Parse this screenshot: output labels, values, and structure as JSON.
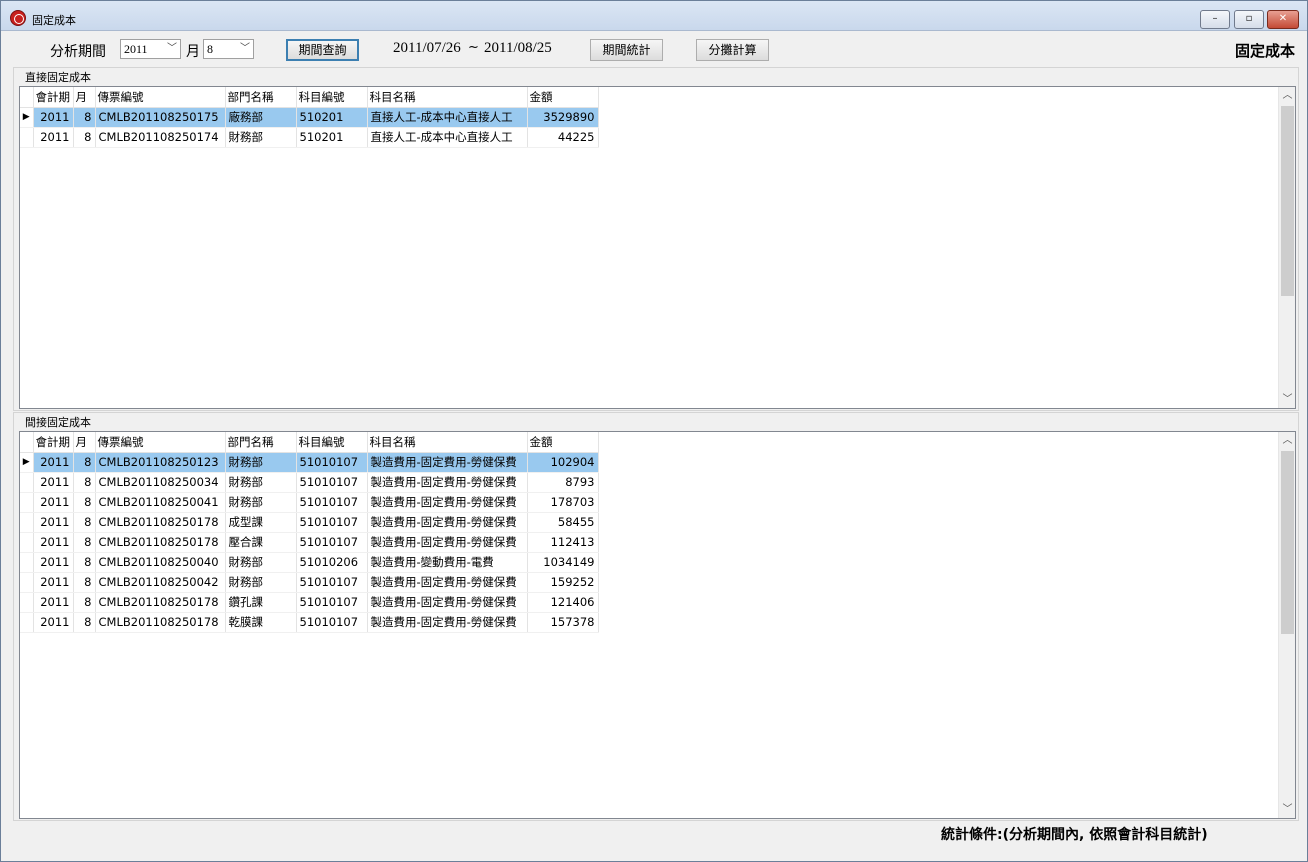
{
  "window": {
    "title": "固定成本",
    "min_label": "–",
    "max_label": "▫",
    "close_label": "✕"
  },
  "toolbar": {
    "period_label": "分析期間",
    "year_value": "2011",
    "month_label": "月",
    "month_value": "8",
    "query_button": "期間查詢",
    "date_start": "2011/07/26",
    "date_sep": "~",
    "date_end": "2011/08/25",
    "stats_button": "期間統計",
    "allocate_button": "分攤計算",
    "page_heading": "固定成本"
  },
  "direct": {
    "title": "直接固定成本",
    "headers": [
      "會計期",
      "月",
      "傳票編號",
      "部門名稱",
      "科目編號",
      "科目名稱",
      "金額"
    ],
    "rows": [
      [
        "2011",
        "8",
        "CMLB201108250175",
        "廠務部",
        "510201",
        "直接人工-成本中心直接人工",
        "3529890"
      ],
      [
        "2011",
        "8",
        "CMLB201108250174",
        "財務部",
        "510201",
        "直接人工-成本中心直接人工",
        "44225"
      ]
    ]
  },
  "indirect": {
    "title": "間接固定成本",
    "headers": [
      "會計期",
      "月",
      "傳票編號",
      "部門名稱",
      "科目編號",
      "科目名稱",
      "金額"
    ],
    "rows": [
      [
        "2011",
        "8",
        "CMLB201108250123",
        "財務部",
        "51010107",
        "製造費用-固定費用-勞健保費",
        "102904"
      ],
      [
        "2011",
        "8",
        "CMLB201108250034",
        "財務部",
        "51010107",
        "製造費用-固定費用-勞健保費",
        "8793"
      ],
      [
        "2011",
        "8",
        "CMLB201108250041",
        "財務部",
        "51010107",
        "製造費用-固定費用-勞健保費",
        "178703"
      ],
      [
        "2011",
        "8",
        "CMLB201108250178",
        "成型課",
        "51010107",
        "製造費用-固定費用-勞健保費",
        "58455"
      ],
      [
        "2011",
        "8",
        "CMLB201108250178",
        "壓合課",
        "51010107",
        "製造費用-固定費用-勞健保費",
        "112413"
      ],
      [
        "2011",
        "8",
        "CMLB201108250040",
        "財務部",
        "51010206",
        "製造費用-變動費用-電費",
        "1034149"
      ],
      [
        "2011",
        "8",
        "CMLB201108250042",
        "財務部",
        "51010107",
        "製造費用-固定費用-勞健保費",
        "159252"
      ],
      [
        "2011",
        "8",
        "CMLB201108250178",
        "鑽孔課",
        "51010107",
        "製造費用-固定費用-勞健保費",
        "121406"
      ],
      [
        "2011",
        "8",
        "CMLB201108250178",
        "乾膜課",
        "51010107",
        "製造費用-固定費用-勞健保費",
        "157378"
      ]
    ]
  },
  "status": {
    "text": "統計條件:(分析期間內, 依照會計科目統計)"
  }
}
